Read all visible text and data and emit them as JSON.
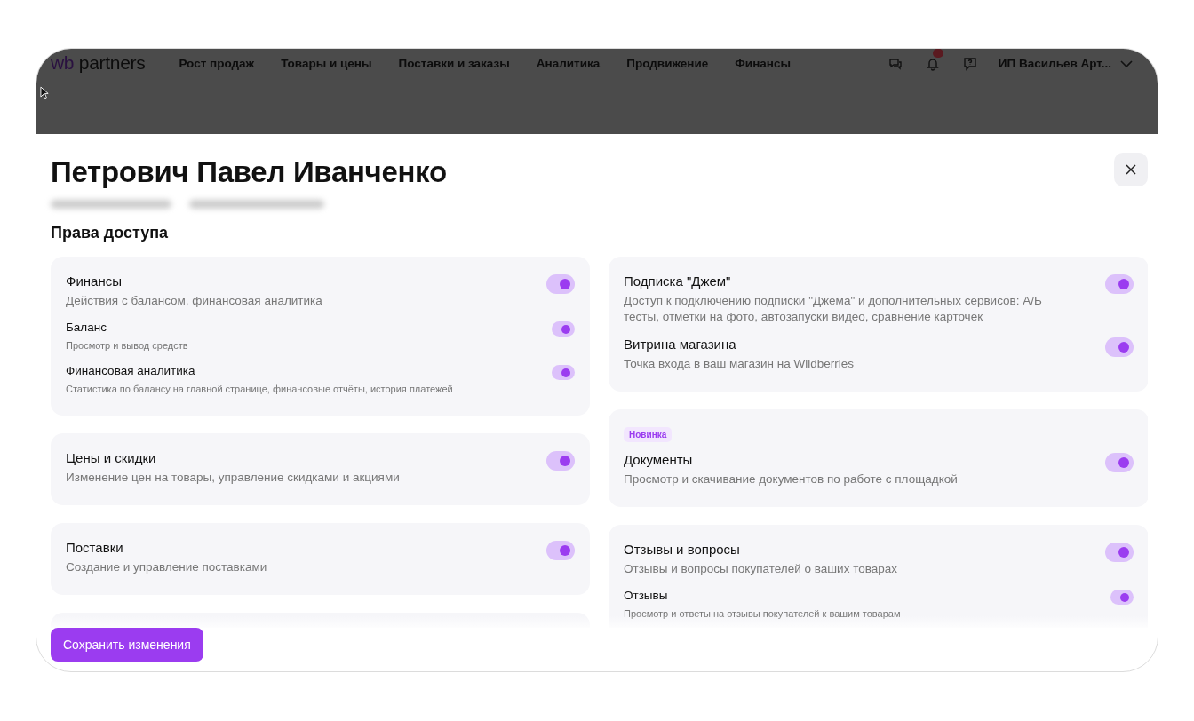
{
  "topbar": {
    "logo": {
      "brand": "wb",
      "product": "partners"
    },
    "nav": [
      "Рост продаж",
      "Товары и цены",
      "Поставки и заказы",
      "Аналитика",
      "Продвижение",
      "Финансы"
    ],
    "user": "ИП Васильев Арт..."
  },
  "modal": {
    "title": "Петрович Павел Иванченко",
    "section_title": "Права доступа",
    "columns": [
      [
        {
          "items": [
            {
              "kind": "main",
              "title": "Финансы",
              "description": "Действия с балансом, финансовая аналитика",
              "on": true
            },
            {
              "kind": "sub",
              "title": "Баланс",
              "description": "Просмотр и вывод средств",
              "on": true
            },
            {
              "kind": "sub",
              "title": "Финансовая аналитика",
              "description": "Статистика по балансу на главной странице, финансовые отчёты, история платежей",
              "on": true
            }
          ]
        },
        {
          "items": [
            {
              "kind": "main",
              "title": "Цены и скидки",
              "description": "Изменение цен на товары, управление скидками и акциями",
              "on": true
            }
          ]
        },
        {
          "items": [
            {
              "kind": "main",
              "title": "Поставки",
              "description": "Создание и управление поставками",
              "on": true
            }
          ]
        }
      ],
      [
        {
          "items": [
            {
              "kind": "main",
              "title": "Подписка \"Джем\"",
              "description": "Доступ к подключению подписки \"Джема\" и дополнительных сервисов: А/Б тесты, отметки на фото, автозапуски видео, сравнение карточек",
              "on": true
            },
            {
              "kind": "main",
              "title": "Витрина магазина",
              "description": "Точка входа в ваш магазин на Wildberries",
              "on": true
            }
          ]
        },
        {
          "badge": "Новинка",
          "items": [
            {
              "kind": "main",
              "title": "Документы",
              "description": "Просмотр и скачивание документов по работе с площадкой",
              "on": true
            }
          ]
        },
        {
          "items": [
            {
              "kind": "main",
              "title": "Отзывы и вопросы",
              "description": "Отзывы и вопросы покупателей о ваших товарах",
              "on": true
            },
            {
              "kind": "sub",
              "title": "Отзывы",
              "description": "Просмотр и ответы на отзывы покупателей к вашим товарам",
              "on": true
            }
          ]
        }
      ]
    ],
    "save_button": "Сохранить изменения"
  }
}
